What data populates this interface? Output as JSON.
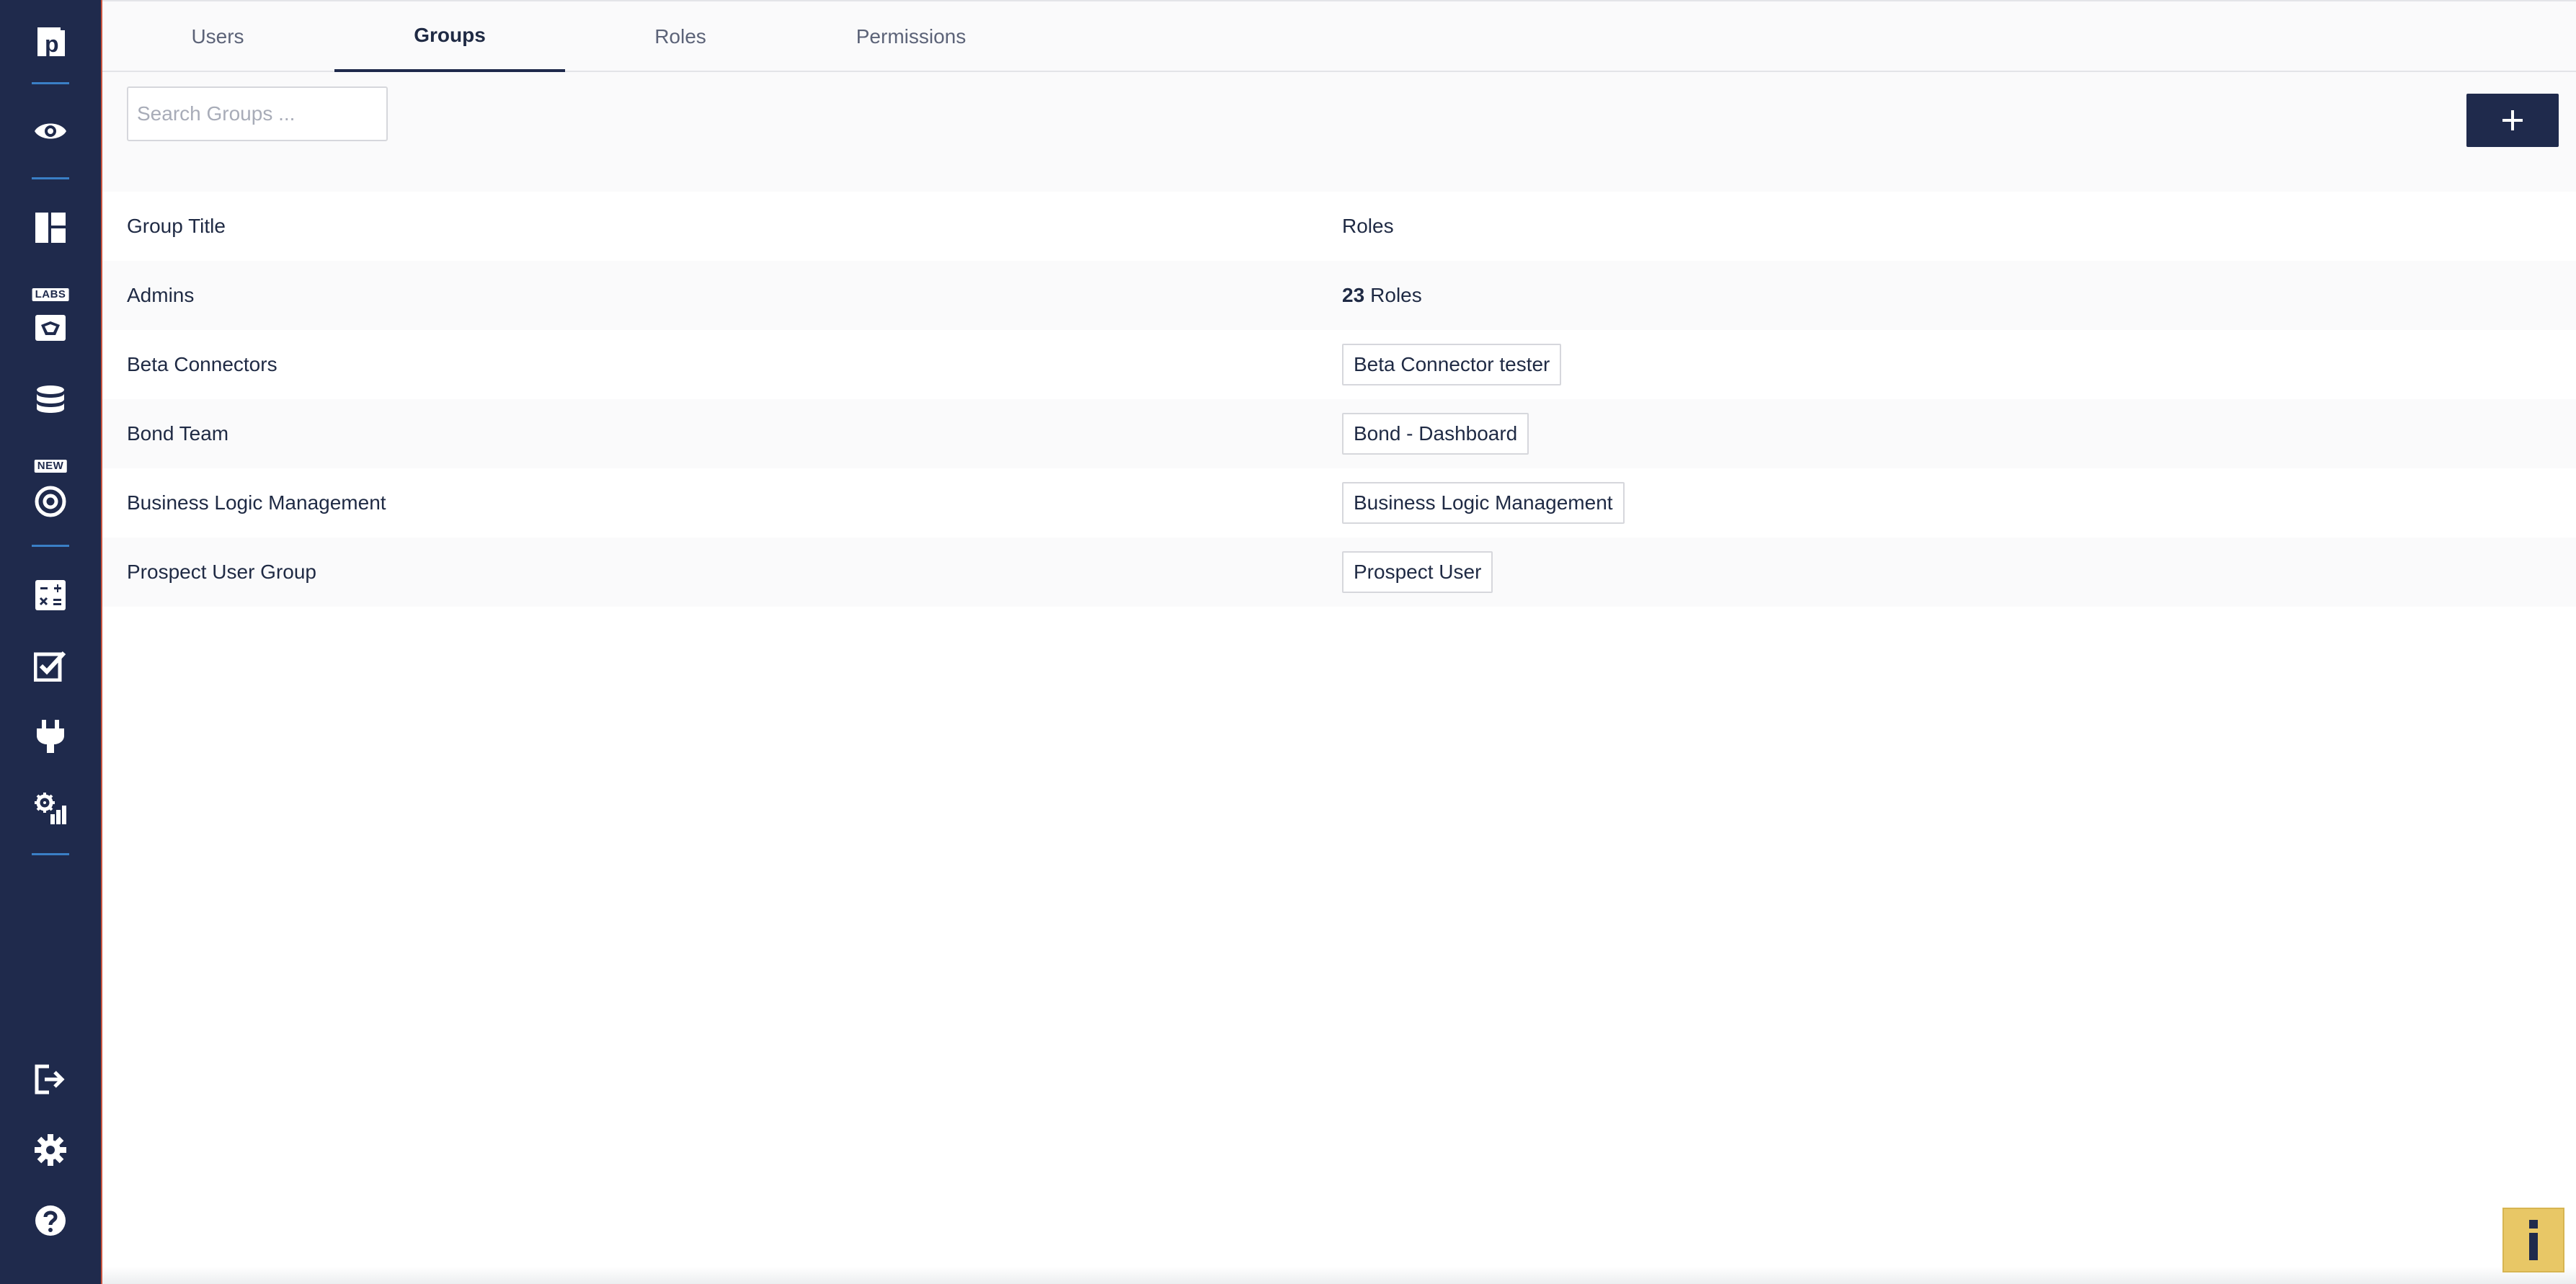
{
  "tabs": [
    {
      "label": "Users",
      "active": false
    },
    {
      "label": "Groups",
      "active": true
    },
    {
      "label": "Roles",
      "active": false
    },
    {
      "label": "Permissions",
      "active": false
    }
  ],
  "search": {
    "placeholder": "Search Groups ..."
  },
  "toolbar": {
    "add_icon": "plus-icon"
  },
  "sidebar": {
    "logo_letter": "p",
    "labs_badge": "LABS",
    "new_badge": "NEW",
    "icons": [
      "logo-icon",
      "eye-icon",
      "dashboard-icon",
      "labs-icon",
      "database-icon",
      "target-icon",
      "calculator-icon",
      "checklist-icon",
      "plug-icon",
      "gear-chart-icon",
      "logout-icon",
      "settings-icon",
      "help-icon"
    ]
  },
  "table": {
    "headers": {
      "title": "Group Title",
      "roles": "Roles"
    },
    "rows": [
      {
        "title": "Admins",
        "roles_count": "23",
        "roles_suffix": "Roles"
      },
      {
        "title": "Beta Connectors",
        "role": "Beta Connector tester"
      },
      {
        "title": "Bond Team",
        "role": "Bond - Dashboard"
      },
      {
        "title": "Business Logic Management",
        "role": "Business Logic Management"
      },
      {
        "title": "Prospect User Group",
        "role": "Prospect User"
      }
    ]
  },
  "colors": {
    "sidebar": "#1f2a4c",
    "accent_divider": "#3a7fc6",
    "info_button": "#e8c766"
  }
}
